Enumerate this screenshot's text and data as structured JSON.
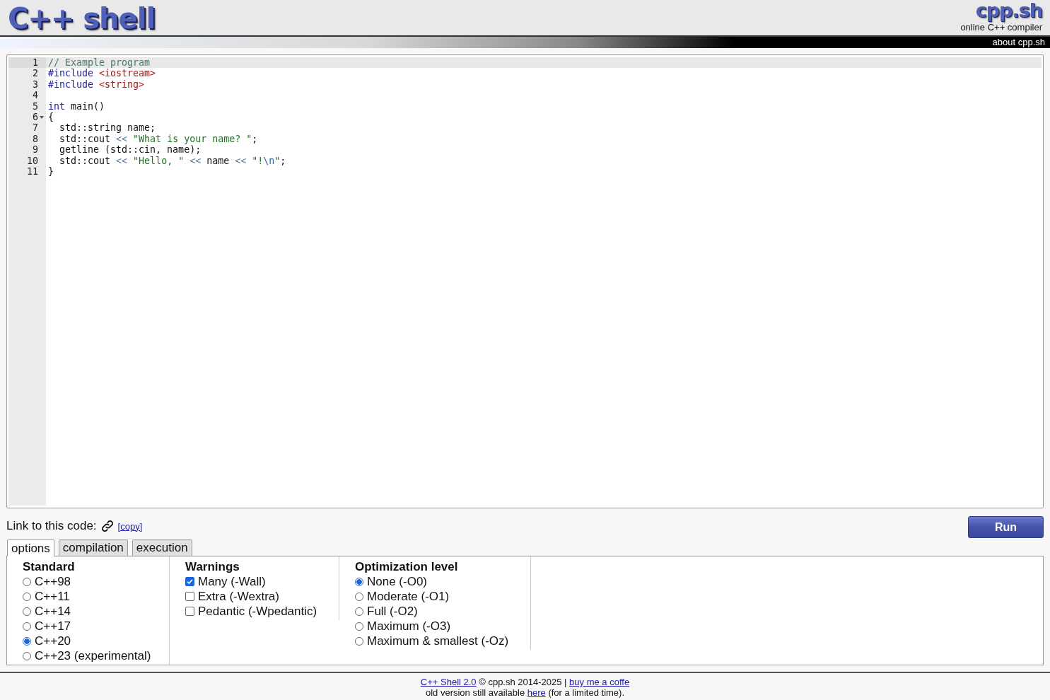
{
  "header": {
    "title": "C++ shell",
    "logo": "cpp.sh",
    "subtitle": "online C++ compiler",
    "about_link": "about cpp.sh"
  },
  "editor": {
    "lines": [
      {
        "number": "1",
        "active": true,
        "foldable": false,
        "tokens": [
          {
            "kind": "comment",
            "text": "// Example program"
          }
        ]
      },
      {
        "number": "2",
        "active": false,
        "foldable": false,
        "tokens": [
          {
            "kind": "keyword",
            "text": "#include"
          },
          {
            "kind": "include",
            "text": " <iostream>"
          }
        ]
      },
      {
        "number": "3",
        "active": false,
        "foldable": false,
        "tokens": [
          {
            "kind": "keyword",
            "text": "#include"
          },
          {
            "kind": "include",
            "text": " <string>"
          }
        ]
      },
      {
        "number": "4",
        "active": false,
        "foldable": false
      },
      {
        "number": "5",
        "active": false,
        "foldable": false,
        "tokens": [
          {
            "kind": "keyword",
            "text": "int"
          },
          {
            "kind": "plain",
            "text": " main()"
          }
        ]
      },
      {
        "number": "6",
        "active": false,
        "foldable": true,
        "tokens": [
          {
            "kind": "plain",
            "text": "{"
          }
        ]
      },
      {
        "number": "7",
        "active": false,
        "foldable": false,
        "tokens": [
          {
            "kind": "plain",
            "text": "  std::string name;"
          }
        ]
      },
      {
        "number": "8",
        "active": false,
        "foldable": false,
        "tokens": [
          {
            "kind": "plain",
            "text": "  std::cout "
          },
          {
            "kind": "operator",
            "text": "<<"
          },
          {
            "kind": "string",
            "text": " \"What is your name? \""
          },
          {
            "kind": "plain",
            "text": ";"
          }
        ]
      },
      {
        "number": "9",
        "active": false,
        "foldable": false,
        "tokens": [
          {
            "kind": "plain",
            "text": "  getline (std::cin, name);"
          }
        ]
      },
      {
        "number": "10",
        "active": false,
        "foldable": false,
        "tokens": [
          {
            "kind": "plain",
            "text": "  std::cout "
          },
          {
            "kind": "operator",
            "text": "<<"
          },
          {
            "kind": "string",
            "text": " \"Hello, \""
          },
          {
            "kind": "operator",
            "text": " <<"
          },
          {
            "kind": "plain",
            "text": " name "
          },
          {
            "kind": "operator",
            "text": "<<"
          },
          {
            "kind": "string",
            "text": " \"!"
          },
          {
            "kind": "escape",
            "text": "\\n"
          },
          {
            "kind": "string",
            "text": "\""
          },
          {
            "kind": "plain",
            "text": ";"
          }
        ]
      },
      {
        "number": "11",
        "active": false,
        "foldable": false,
        "tokens": [
          {
            "kind": "plain",
            "text": "}"
          }
        ]
      }
    ]
  },
  "link_row": {
    "label": "Link to this code:",
    "copy_link": "[copy]"
  },
  "run_button": "Run",
  "tabs": [
    {
      "label": "options",
      "selected": true
    },
    {
      "label": "compilation",
      "selected": false
    },
    {
      "label": "execution",
      "selected": false
    }
  ],
  "option_groups": [
    {
      "title": "Standard",
      "kind": "radio",
      "options": [
        {
          "label": "C++98",
          "selected": false
        },
        {
          "label": "C++11",
          "selected": false
        },
        {
          "label": "C++14",
          "selected": false
        },
        {
          "label": "C++17",
          "selected": false
        },
        {
          "label": "C++20",
          "selected": true
        },
        {
          "label": "C++23 (experimental)",
          "selected": false
        }
      ]
    },
    {
      "title": "Warnings",
      "kind": "checkbox",
      "options": [
        {
          "label": "Many (-Wall)",
          "checked": true
        },
        {
          "label": "Extra (-Wextra)",
          "checked": false
        },
        {
          "label": "Pedantic (-Wpedantic)",
          "checked": false
        }
      ]
    },
    {
      "title": "Optimization level",
      "kind": "radio",
      "options": [
        {
          "label": "None (-O0)",
          "selected": true
        },
        {
          "label": "Moderate (-O1)",
          "selected": false
        },
        {
          "label": "Full (-O2)",
          "selected": false
        },
        {
          "label": "Maximum (-O3)",
          "selected": false
        },
        {
          "label": "Maximum & smallest (-Oz)",
          "selected": false
        }
      ]
    }
  ],
  "footer": {
    "lines": [
      [
        {
          "kind": "link",
          "text": "C++ Shell 2.0"
        },
        {
          "kind": "text",
          "text": " © cpp.sh 2014-2025 | "
        },
        {
          "kind": "link",
          "text": "buy me a coffe"
        }
      ],
      [
        {
          "kind": "text",
          "text": "old version still available "
        },
        {
          "kind": "link",
          "text": "here"
        },
        {
          "kind": "text",
          "text": " (for a limited time)."
        }
      ]
    ]
  }
}
